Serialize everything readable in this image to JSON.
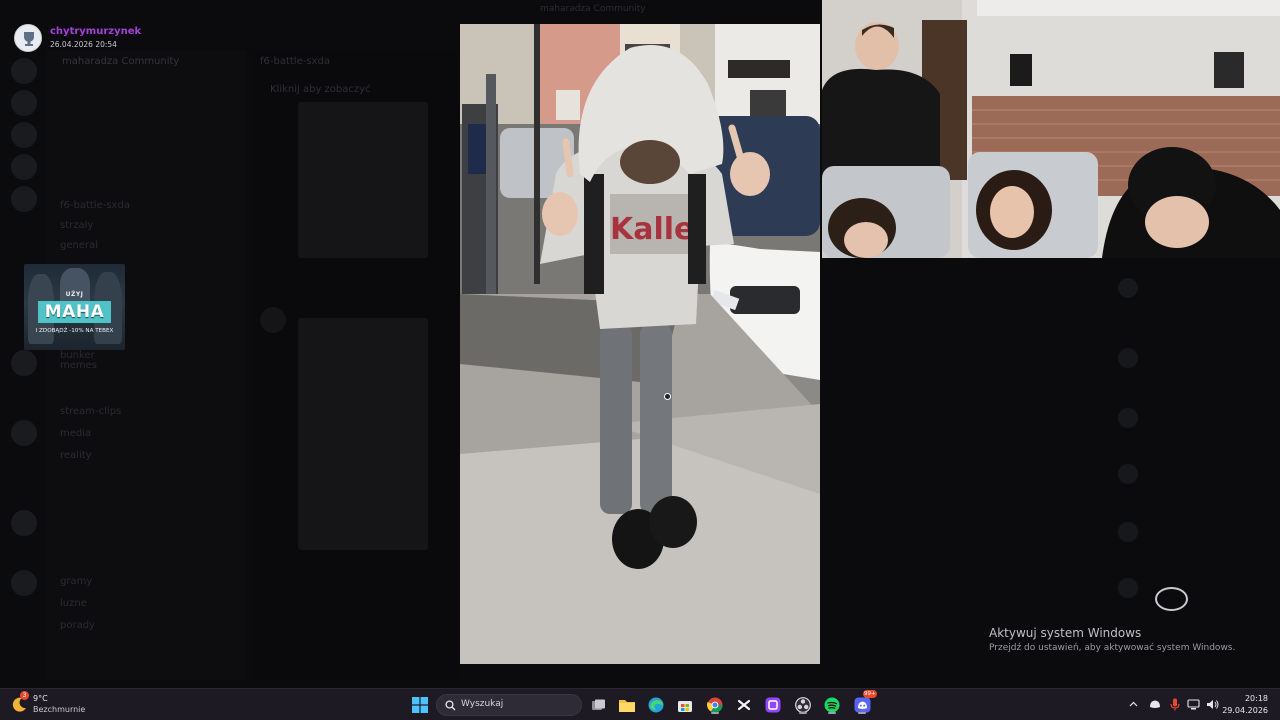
{
  "viewer": {
    "username": "chytrymurzynek",
    "date": "26.04.2026 20:54"
  },
  "background": {
    "window_title": "maharadza Community",
    "server_name": "maharadza Community",
    "channels": [
      "f6-battle-sxda",
      "strzaly",
      "general",
      "bunker",
      "memes",
      "stream-clips",
      "media",
      "reality",
      "gramy",
      "luzne",
      "porady"
    ],
    "chat_tab": "f6-battle-sxda",
    "pinned_notice": "Kliknij aby zobaczyć"
  },
  "ad": {
    "top_text": "UŻYJ",
    "big_text": "MAHA",
    "promo_text": "I ZDOBĄDŹ -10% NA TEBEX"
  },
  "watermark": {
    "title": "Aktywuj system Windows",
    "subtitle": "Przejdź do ustawień, aby aktywować system Windows."
  },
  "taskbar": {
    "weather_temp": "9°C",
    "weather_desc": "Bezchmurnie",
    "weather_badge": "3",
    "search_placeholder": "Wyszukaj",
    "time": "20:18",
    "date": "29.04.2026",
    "discord_badge": "99+",
    "apps": [
      "windows-start",
      "search",
      "task-view",
      "file-explorer",
      "edge",
      "microsoft-store",
      "chrome",
      "capcut",
      "twitch-app",
      "obs",
      "spotify",
      "discord"
    ]
  },
  "colors": {
    "username": "#a440d8",
    "taskbar_bg": "#1e1a24",
    "ad_accent": "#4fc3c7"
  }
}
